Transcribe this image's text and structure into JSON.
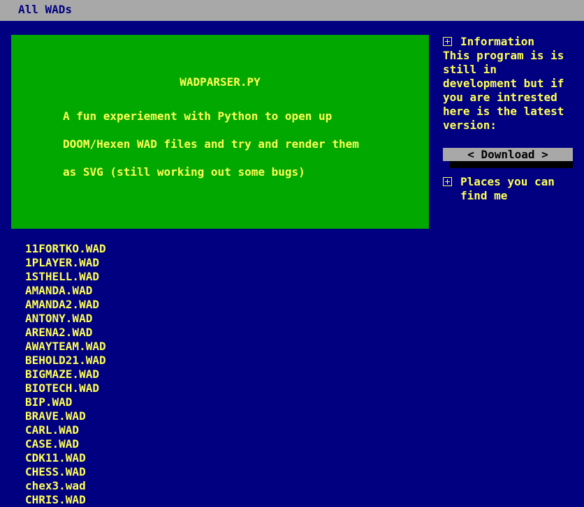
{
  "nav": {
    "all_wads_label": "All WADs"
  },
  "hero": {
    "title": "WADPARSER.PY",
    "lines": [
      "A fun experiement with Python to open up",
      "DOOM/Hexen WAD files and try and render them",
      "as SVG (still working out some bugs)"
    ]
  },
  "sidebar": {
    "information": {
      "heading": "Information",
      "text": "This program is is still in development but if you are intrested here is the latest version:",
      "download_label": "< Download >"
    },
    "places": {
      "heading": "Places you can find me"
    }
  },
  "wads": [
    "11FORTKO.WAD",
    "1PLAYER.WAD",
    "1STHELL.WAD",
    "AMANDA.WAD",
    "AMANDA2.WAD",
    "ANTONY.WAD",
    "ARENA2.WAD",
    "AWAYTEAM.WAD",
    "BEHOLD21.WAD",
    "BIGMAZE.WAD",
    "BIOTECH.WAD",
    "BIP.WAD",
    "BRAVE.WAD",
    "CARL.WAD",
    "CASE.WAD",
    "CDK11.WAD",
    "CHESS.WAD",
    "chex3.wad",
    "CHRIS.WAD"
  ],
  "colors": {
    "background": "#000080",
    "topbar": "#a8a8a8",
    "hero": "#00a800",
    "text": "#ffff55",
    "button": "#a8a8a8",
    "shadow": "#000000"
  }
}
